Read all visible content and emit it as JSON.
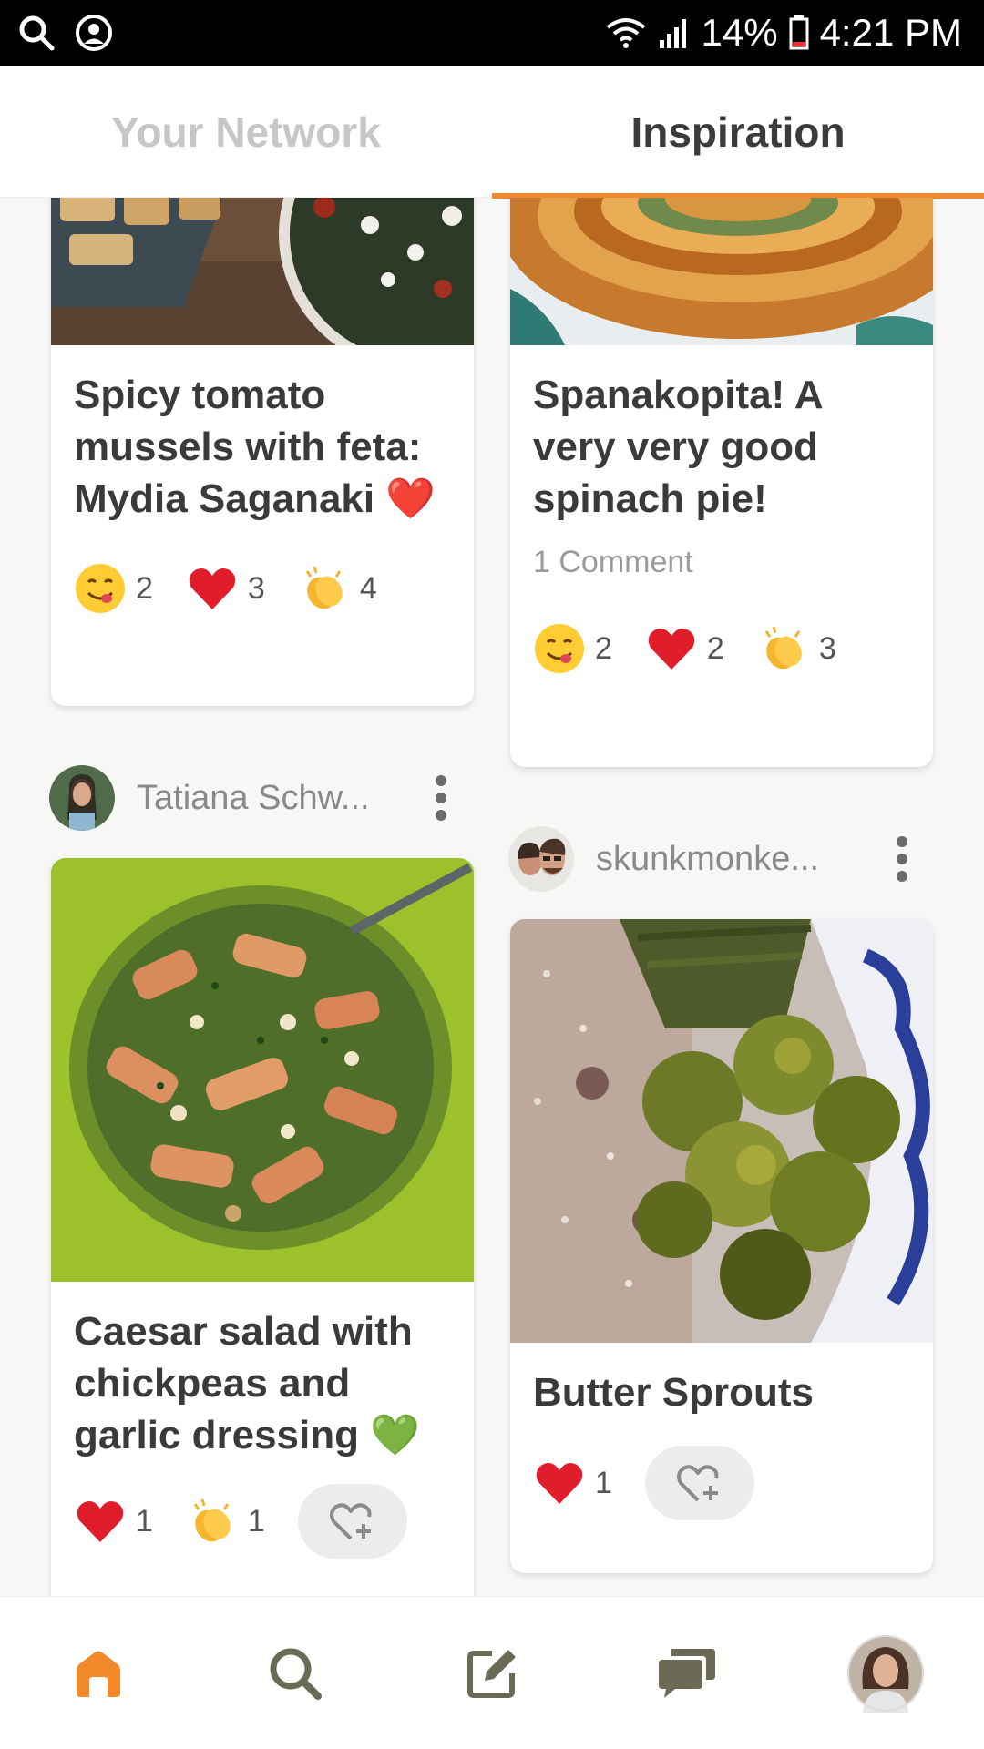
{
  "status_bar": {
    "battery": "14%",
    "time": "4:21 PM",
    "icons": [
      "search-icon",
      "account-icon",
      "wifi-icon",
      "signal-icon",
      "battery-icon"
    ]
  },
  "tabs": [
    {
      "label": "Your Network",
      "active": false
    },
    {
      "label": "Inspiration",
      "active": true
    }
  ],
  "accent_color": "#f28a2c",
  "posts": [
    {
      "title": "Spicy tomato mussels with feta: Mydia Saganaki ❤️",
      "reactions": [
        {
          "emoji": "yum-face",
          "count": "2"
        },
        {
          "emoji": "red-heart",
          "count": "3"
        },
        {
          "emoji": "clapping-hands",
          "count": "4"
        }
      ]
    },
    {
      "title": "Spanakopita! A very very good spinach pie!",
      "comments": "1 Comment",
      "reactions": [
        {
          "emoji": "yum-face",
          "count": "2"
        },
        {
          "emoji": "red-heart",
          "count": "2"
        },
        {
          "emoji": "clapping-hands",
          "count": "3"
        }
      ]
    },
    {
      "author": "Tatiana Schw...",
      "title": "Caesar salad with chickpeas and garlic dressing 💚",
      "reactions": [
        {
          "emoji": "red-heart",
          "count": "1"
        },
        {
          "emoji": "clapping-hands",
          "count": "1"
        }
      ]
    },
    {
      "author": "skunkmonke...",
      "title": "Butter Sprouts",
      "reactions": [
        {
          "emoji": "red-heart",
          "count": "1"
        }
      ]
    }
  ],
  "bottom_nav": [
    "home-icon",
    "search-icon",
    "compose-icon",
    "chat-icon",
    "profile-avatar"
  ]
}
